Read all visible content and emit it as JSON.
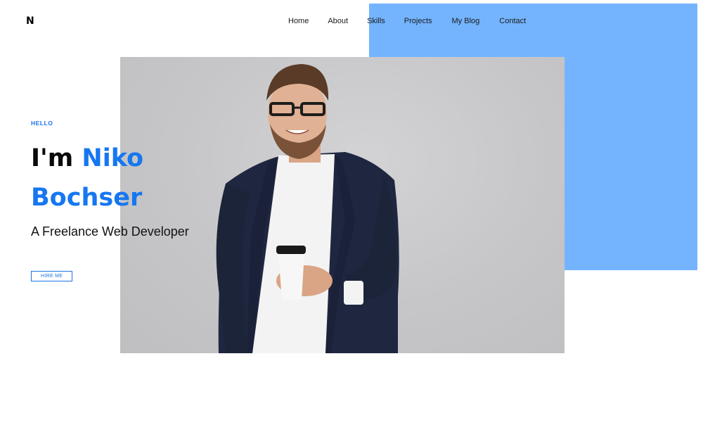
{
  "brand": {
    "logo": "N"
  },
  "nav": {
    "items": [
      {
        "label": "Home"
      },
      {
        "label": "About"
      },
      {
        "label": "Skills"
      },
      {
        "label": "Projects"
      },
      {
        "label": "My Blog"
      },
      {
        "label": "Contact"
      }
    ]
  },
  "hero": {
    "eyebrow": "HELLO",
    "intro": "I'm",
    "first_name": "Niko",
    "last_name": "Bochser",
    "subtitle": "A Freelance Web Developer",
    "cta": "HIRE ME"
  },
  "colors": {
    "accent": "#1677f0",
    "panel": "#74b4ff",
    "photo_bg": "#c6c6c8"
  }
}
